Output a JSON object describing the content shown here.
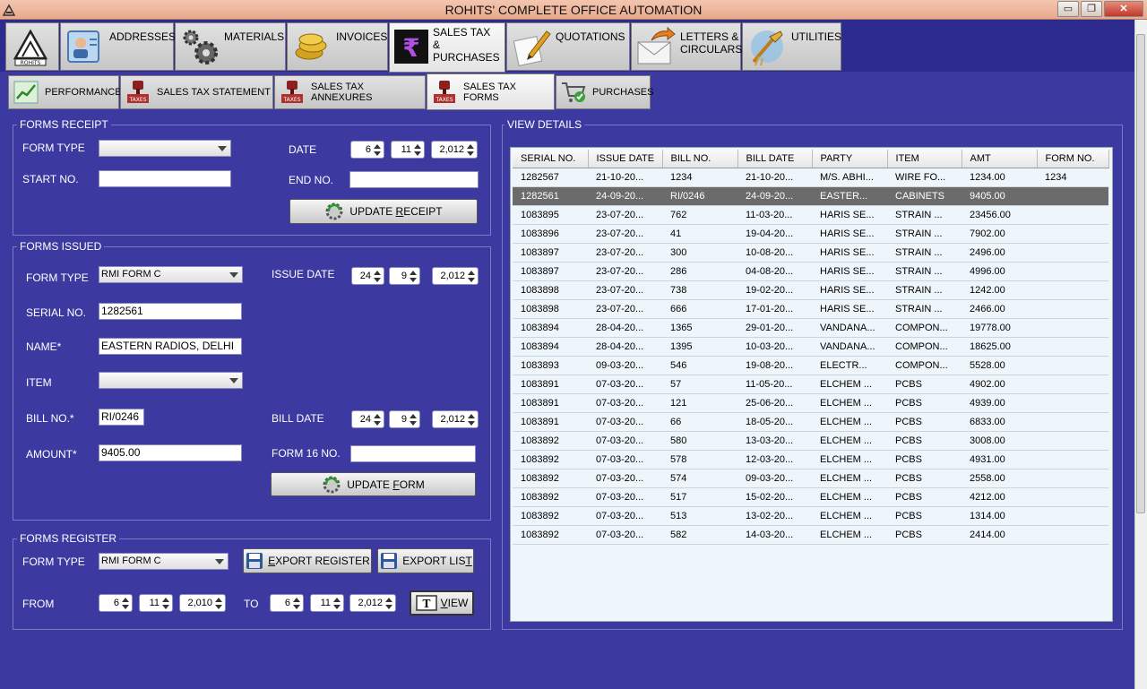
{
  "window": {
    "title": "ROHITS' COMPLETE OFFICE AUTOMATION",
    "minimize": "▭",
    "maximize": "❐",
    "close": "✕"
  },
  "main_tabs": [
    {
      "label": "",
      "icon": "rohits-logo-icon"
    },
    {
      "label": "ADDRESSES",
      "icon": "address-card-icon"
    },
    {
      "label": "MATERIALS",
      "icon": "gears-icon"
    },
    {
      "label": "INVOICES",
      "icon": "coins-icon"
    },
    {
      "label": "SALES TAX\n& PURCHASES",
      "icon": "rupee-icon",
      "active": true
    },
    {
      "label": "QUOTATIONS",
      "icon": "pencil-notepad-icon"
    },
    {
      "label": "LETTERS &\nCIRCULARS",
      "icon": "envelope-arrow-icon"
    },
    {
      "label": "UTILITIES",
      "icon": "broom-tools-icon"
    }
  ],
  "sub_tabs": [
    {
      "label": "PERFORMANCE",
      "icon": "line-chart-icon"
    },
    {
      "label": "SALES TAX STATEMENT",
      "icon": "taxes-stamp-icon"
    },
    {
      "label": "SALES TAX ANNEXURES",
      "icon": "taxes-stamp-icon"
    },
    {
      "label": "SALES TAX FORMS",
      "icon": "taxes-stamp-icon",
      "active": true
    },
    {
      "label": "PURCHASES",
      "icon": "shopping-cart-icon"
    }
  ],
  "forms_receipt": {
    "title": "FORMS RECEIPT",
    "form_type_label": "FORM TYPE",
    "form_type_value": "",
    "date_label": "DATE",
    "date_day": "6",
    "date_month": "11",
    "date_year": "2,012",
    "start_no_label": "START NO.",
    "start_no_value": "",
    "end_no_label": "END NO.",
    "end_no_value": "",
    "update_button_pre": "UPDATE ",
    "update_button_mn": "R",
    "update_button_post": "ECEIPT"
  },
  "forms_issued": {
    "title": "FORMS ISSUED",
    "form_type_label": "FORM TYPE",
    "form_type_value": "RMI FORM C",
    "issue_date_label": "ISSUE DATE",
    "issue_day": "24",
    "issue_month": "9",
    "issue_year": "2,012",
    "serial_label": "SERIAL NO.",
    "serial_value": "1282561",
    "name_label": "NAME*",
    "name_value": "EASTERN RADIOS, DELHI",
    "item_label": "ITEM",
    "item_value": "",
    "bill_no_label": "BILL NO.*",
    "bill_no_value": "RI/0246",
    "bill_date_label": "BILL DATE",
    "bill_day": "24",
    "bill_month": "9",
    "bill_year": "2,012",
    "amount_label": "AMOUNT*",
    "amount_value": "9405.00",
    "form16_label": "FORM 16 NO.",
    "form16_value": "",
    "update_button_pre": "UPDATE ",
    "update_button_mn": "F",
    "update_button_post": "ORM"
  },
  "forms_register": {
    "title": "FORMS REGISTER",
    "form_type_label": "FORM TYPE",
    "form_type_value": "RMI FORM C",
    "export_register_mn": "E",
    "export_register_post": "XPORT REGISTER",
    "export_list_pre": "EXPORT LIS",
    "export_list_mn": "T",
    "from_label": "FROM",
    "from_day": "6",
    "from_month": "11",
    "from_year": "2,010",
    "to_label": "TO",
    "to_day": "6",
    "to_month": "11",
    "to_year": "2,012",
    "view_mn": "V",
    "view_post": "IEW"
  },
  "view_details": {
    "title": "VIEW DETAILS",
    "columns": [
      "SERIAL NO.",
      "ISSUE DATE",
      "BILL NO.",
      "BILL DATE",
      "PARTY",
      "ITEM",
      "AMT",
      "FORM NO."
    ],
    "rows": [
      [
        "1282567",
        "21-10-20...",
        "1234",
        "21-10-20...",
        "M/S. ABHI...",
        "WIRE FO...",
        "1234.00",
        "1234"
      ],
      [
        "1282561",
        "24-09-20...",
        "RI/0246",
        "24-09-20...",
        "EASTER...",
        "CABINETS",
        "9405.00",
        ""
      ],
      [
        "1083895",
        "23-07-20...",
        "762",
        "11-03-20...",
        "HARIS SE...",
        "STRAIN ...",
        "23456.00",
        ""
      ],
      [
        "1083896",
        "23-07-20...",
        "41",
        "19-04-20...",
        "HARIS SE...",
        "STRAIN ...",
        "7902.00",
        ""
      ],
      [
        "1083897",
        "23-07-20...",
        "300",
        "10-08-20...",
        "HARIS SE...",
        "STRAIN ...",
        "2496.00",
        ""
      ],
      [
        "1083897",
        "23-07-20...",
        "286",
        "04-08-20...",
        "HARIS SE...",
        "STRAIN ...",
        "4996.00",
        ""
      ],
      [
        "1083898",
        "23-07-20...",
        "738",
        "19-02-20...",
        "HARIS SE...",
        "STRAIN ...",
        "1242.00",
        ""
      ],
      [
        "1083898",
        "23-07-20...",
        "666",
        "17-01-20...",
        "HARIS SE...",
        "STRAIN ...",
        "2466.00",
        ""
      ],
      [
        "1083894",
        "28-04-20...",
        "1365",
        "29-01-20...",
        "VANDANA...",
        "COMPON...",
        "19778.00",
        ""
      ],
      [
        "1083894",
        "28-04-20...",
        "1395",
        "10-03-20...",
        "VANDANA...",
        "COMPON...",
        "18625.00",
        ""
      ],
      [
        "1083893",
        "09-03-20...",
        "546",
        "19-08-20...",
        "ELECTR...",
        "COMPON...",
        "5528.00",
        ""
      ],
      [
        "1083891",
        "07-03-20...",
        "57",
        "11-05-20...",
        "ELCHEM ...",
        "PCBS",
        "4902.00",
        ""
      ],
      [
        "1083891",
        "07-03-20...",
        "121",
        "25-06-20...",
        "ELCHEM ...",
        "PCBS",
        "4939.00",
        ""
      ],
      [
        "1083891",
        "07-03-20...",
        "66",
        "18-05-20...",
        "ELCHEM ...",
        "PCBS",
        "6833.00",
        ""
      ],
      [
        "1083892",
        "07-03-20...",
        "580",
        "13-03-20...",
        "ELCHEM ...",
        "PCBS",
        "3008.00",
        ""
      ],
      [
        "1083892",
        "07-03-20...",
        "578",
        "12-03-20...",
        "ELCHEM ...",
        "PCBS",
        "4931.00",
        ""
      ],
      [
        "1083892",
        "07-03-20...",
        "574",
        "09-03-20...",
        "ELCHEM ...",
        "PCBS",
        "2558.00",
        ""
      ],
      [
        "1083892",
        "07-03-20...",
        "517",
        "15-02-20...",
        "ELCHEM ...",
        "PCBS",
        "4212.00",
        ""
      ],
      [
        "1083892",
        "07-03-20...",
        "513",
        "13-02-20...",
        "ELCHEM ...",
        "PCBS",
        "1314.00",
        ""
      ],
      [
        "1083892",
        "07-03-20...",
        "582",
        "14-03-20...",
        "ELCHEM ...",
        "PCBS",
        "2414.00",
        ""
      ]
    ],
    "selected_row": 1
  },
  "colors": {
    "background": "#3c3aa0",
    "titlebar": "#efb8a0",
    "selected_row": "#6b6b6b"
  }
}
